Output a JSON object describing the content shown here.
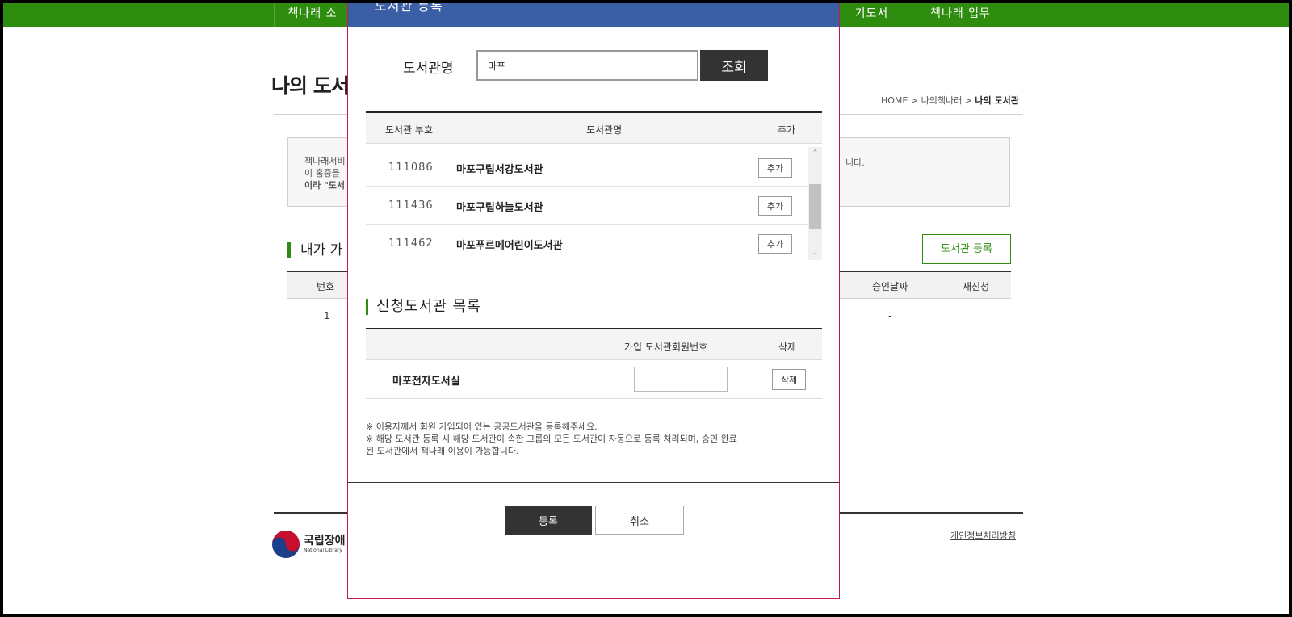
{
  "topnav": {
    "items": [
      "책나래 소",
      "기도서",
      "책나래 업무"
    ]
  },
  "page": {
    "title": "나의 도서",
    "breadcrumb": {
      "home": "HOME",
      "section": "나의책나래",
      "current": "나의 도서관"
    },
    "notice_lines": [
      "책나래서비",
      "이 홈중을",
      "이라 \"도서"
    ],
    "notice_tail": "니다.",
    "section_title": "내가 가",
    "register_library_button": "도서관 등록",
    "table": {
      "headers": [
        "번호",
        "승인날짜",
        "재신청"
      ],
      "rows": [
        {
          "no": "1",
          "approval_date": "-"
        }
      ]
    },
    "footer": {
      "logo_label": "국립장애",
      "logo_sub": "National Library",
      "privacy_link": "개인정보처리방침"
    }
  },
  "modal": {
    "title": "도서관 등록",
    "search": {
      "label": "도서관명",
      "value": "마포",
      "button": "조회"
    },
    "library_table": {
      "headers": [
        "도서관 부호",
        "도서관명",
        "추가"
      ],
      "rows": [
        {
          "code": "111086",
          "name": "마포구립서강도서관",
          "action": "추가"
        },
        {
          "code": "111436",
          "name": "마포구립하늘도서관",
          "action": "추가"
        },
        {
          "code": "111462",
          "name": "마포푸르메어린이도서관",
          "action": "추가"
        }
      ]
    },
    "applied": {
      "title": "신청도서관 목록",
      "headers": [
        "가입 도서관회원번호",
        "삭제"
      ],
      "rows": [
        {
          "name": "마포전자도서실",
          "member_no": "",
          "action": "삭제"
        }
      ]
    },
    "notes": [
      "※ 이용자께서 회원 가입되어 있는 공공도서관을 등록해주세요.",
      "※ 해당 도서관 등록 시 해당 도서관이 속한 그룹의 모든 도서관이 자동으로 등록 처리되며, 승인 완료",
      "된 도서관에서 책나래 이용이 가능합니다."
    ],
    "submit_button": "등록",
    "cancel_button": "취소"
  },
  "colors": {
    "nav_green": "#2e8c0e",
    "modal_header_blue": "#3a5fa5",
    "dark_button": "#333333"
  }
}
